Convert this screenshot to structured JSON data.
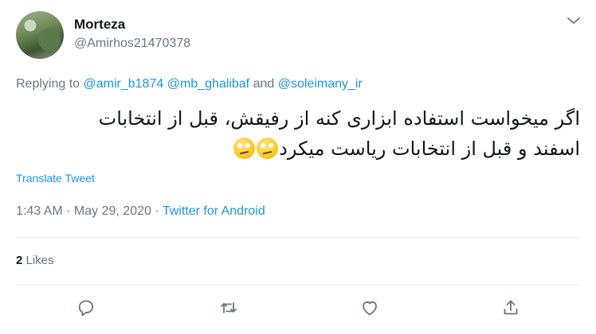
{
  "author": {
    "name": "Morteza",
    "handle": "@Amirhos21470378"
  },
  "reply": {
    "prefix": "Replying to ",
    "mention1": "@amir_b1874",
    "mention2": "@mb_ghalibaf",
    "conjunction": " and ",
    "mention3": "@soleimany_ir"
  },
  "tweet": {
    "line1": "اگر میخواست استفاده ابزاری کنه از رفیقش، قبل از انتخابات",
    "line2": "اسفند و قبل از انتخابات ریاست میکرد",
    "emoji": "face-with-rolling-eyes"
  },
  "translate_label": "Translate Tweet",
  "meta": {
    "time": "1:43 AM",
    "sep1": " · ",
    "date": "May 29, 2020",
    "sep2": " · ",
    "source": "Twitter for Android"
  },
  "likes": {
    "count": "2",
    "label": " Likes"
  },
  "colors": {
    "link": "#1b95e0",
    "secondary": "#657786",
    "divider": "#e6ecf0"
  },
  "icons": [
    "chevron-down-icon",
    "reply-icon",
    "retweet-icon",
    "like-icon",
    "share-icon"
  ]
}
